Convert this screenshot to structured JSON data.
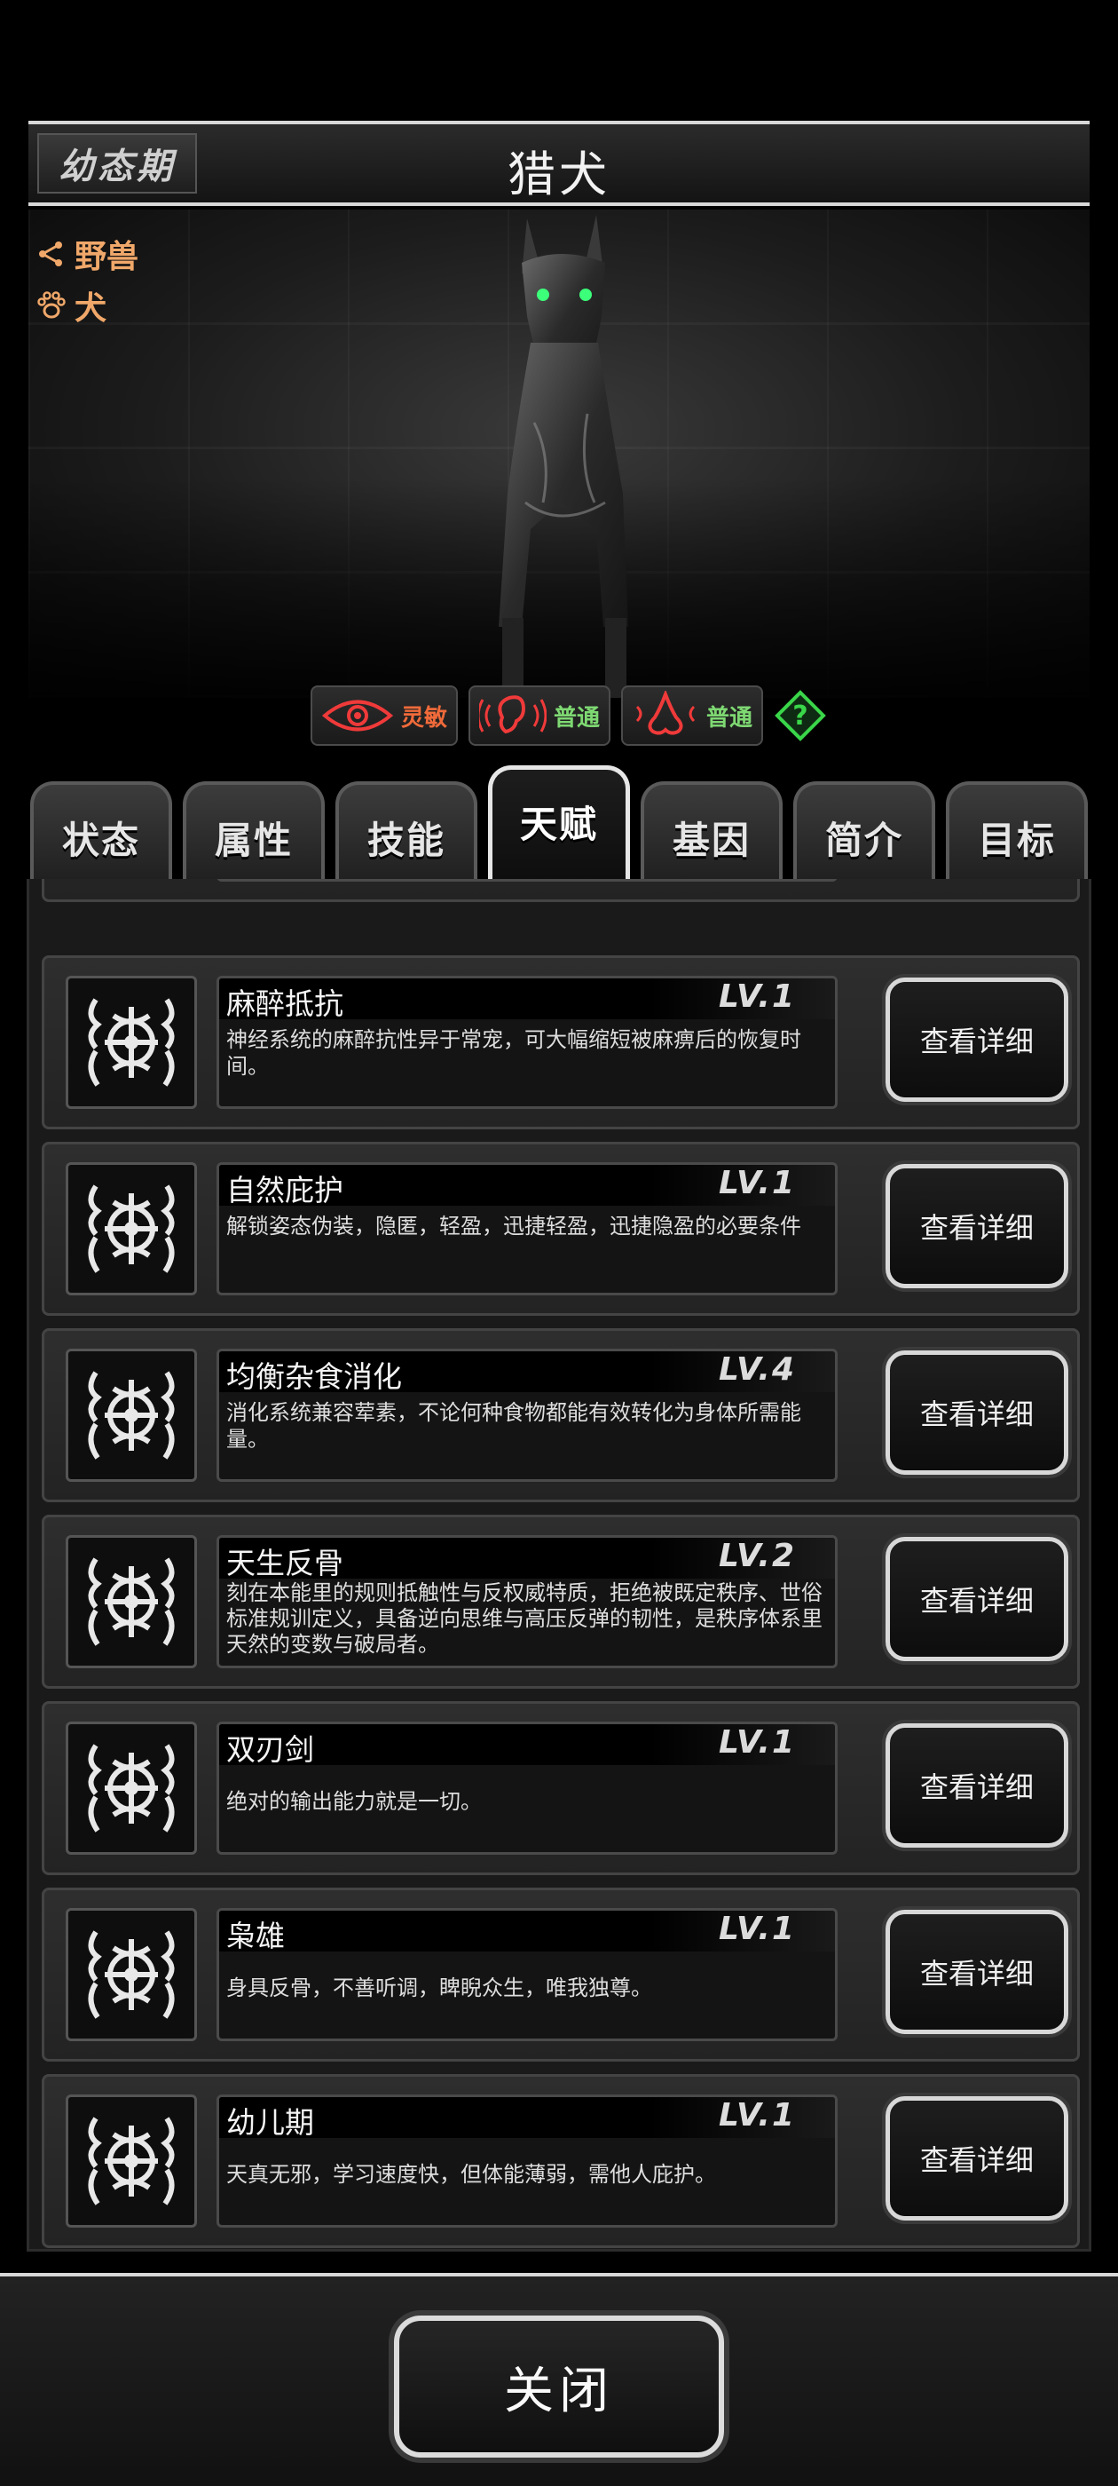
{
  "header": {
    "stage": "幼态期",
    "name": "猎犬"
  },
  "tags": [
    {
      "icon": "share-node-icon",
      "label": "野兽"
    },
    {
      "icon": "paw-icon",
      "label": "犬"
    }
  ],
  "senses": [
    {
      "icon": "eye-icon",
      "label": "灵敏",
      "color": "#f06a3a"
    },
    {
      "icon": "ear-icon",
      "label": "普通",
      "color": "#7ed872"
    },
    {
      "icon": "nose-icon",
      "label": "普通",
      "color": "#7ed872"
    }
  ],
  "help": {
    "icon": "question-diamond-icon"
  },
  "tabs": [
    {
      "label": "状态"
    },
    {
      "label": "属性"
    },
    {
      "label": "技能"
    },
    {
      "label": "天赋",
      "active": true
    },
    {
      "label": "基因"
    },
    {
      "label": "简介"
    },
    {
      "label": "目标"
    }
  ],
  "talents": [
    {
      "name": "麻醉抵抗",
      "level": "LV.1",
      "desc": "神经系统的麻醉抗性异于常宠，可大幅缩短被麻痹后的恢复时间。",
      "button": "查看详细"
    },
    {
      "name": "自然庇护",
      "level": "LV.1",
      "desc": "解锁姿态伪装，隐匿，轻盈，迅捷轻盈，迅捷隐盈的必要条件",
      "button": "查看详细"
    },
    {
      "name": "均衡杂食消化",
      "level": "LV.4",
      "desc": "消化系统兼容荤素，不论何种食物都能有效转化为身体所需能量。",
      "button": "查看详细"
    },
    {
      "name": "天生反骨",
      "level": "LV.2",
      "desc": "刻在本能里的规则抵触性与反权威特质，拒绝被既定秩序、世俗标准规训定义，具备逆向思维与高压反弹的韧性，是秩序体系里天然的变数与破局者。",
      "button": "查看详细"
    },
    {
      "name": "双刃剑",
      "level": "LV.1",
      "desc": "绝对的输出能力就是一切。",
      "button": "查看详细"
    },
    {
      "name": "枭雄",
      "level": "LV.1",
      "desc": "身具反骨，不善听调，睥睨众生，唯我独尊。",
      "button": "查看详细"
    },
    {
      "name": "幼儿期",
      "level": "LV.1",
      "desc": "天真无邪，学习速度快，但体能薄弱，需他人庇护。",
      "button": "查看详细"
    }
  ],
  "footer": {
    "close_label": "关闭"
  }
}
